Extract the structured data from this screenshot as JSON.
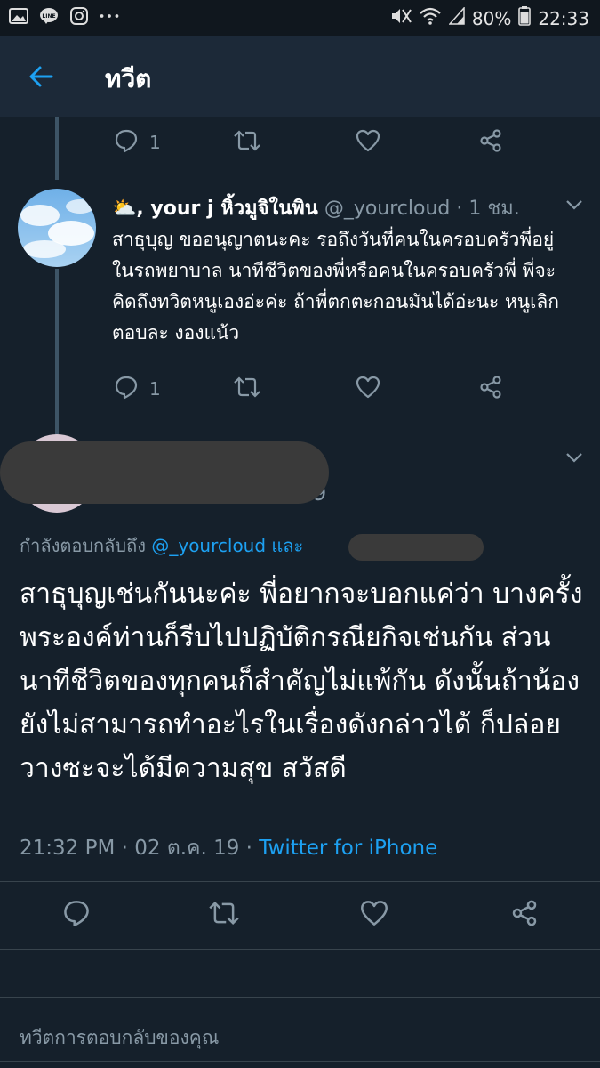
{
  "statusbar": {
    "battery": "80%",
    "time": "22:33",
    "left_icons": [
      "gallery-icon",
      "line-app-icon",
      "instagram-icon",
      "more-icon"
    ],
    "right_icons": [
      "mute-icon",
      "wifi-icon",
      "signal-icon",
      "battery-icon"
    ]
  },
  "appbar": {
    "title": "ทวีต",
    "back_icon": "back-arrow-icon"
  },
  "prev_actions": {
    "reply_count": "1"
  },
  "reply_tweet": {
    "display_name": "⛅, your j หิ้วมูจิในพิน",
    "handle": "@_yourcloud",
    "separator": " · ",
    "time": "1 ชม.",
    "text": "สาธุบุญ ขออนุญาตนะคะ รอถึงวันที่คนในครอบครัวพี่อยู่ในรถพยาบาล นาทีชีวิตของพี่หรือคนในครอบครัวพี่ พี่จะคิดถึงทวิตหนูเองอ่ะค่ะ ถ้าพี่ตกตะกอนมันได้อ่ะนะ หนูเลิกตอบละ งองแน้ว",
    "reply_count": "1"
  },
  "main_tweet": {
    "handle_partial": "9",
    "reply_to_prefix": "กำลังตอบกลับถึง ",
    "reply_to_handle": "@_yourcloud และ",
    "text": "สาธุบุญเช่นกันนะค่ะ พี่อยากจะบอกแค่ว่า บางครั้งพระองค์ท่านก็รีบไปปฏิบัติกรณียกิจเช่นกัน ส่วนนาทีชีวิตของทุกคนก็สำคัญไม่แพ้กัน ดังนั้นถ้าน้องยังไม่สามารถทำอะไรในเรื่องดังกล่าวได้ ก็ปล่อยวางซะจะได้มีความสุข สวัสดี",
    "timestamp": "21:32 PM · 02 ต.ค. 19 · ",
    "via": "Twitter for iPhone"
  },
  "compose": {
    "placeholder": "ทวีตการตอบกลับของคุณ"
  },
  "colors": {
    "background": "#15202b",
    "appbar": "#1c2938",
    "accent": "#1da1f2",
    "muted": "#8899a6",
    "divider": "#38444d"
  }
}
